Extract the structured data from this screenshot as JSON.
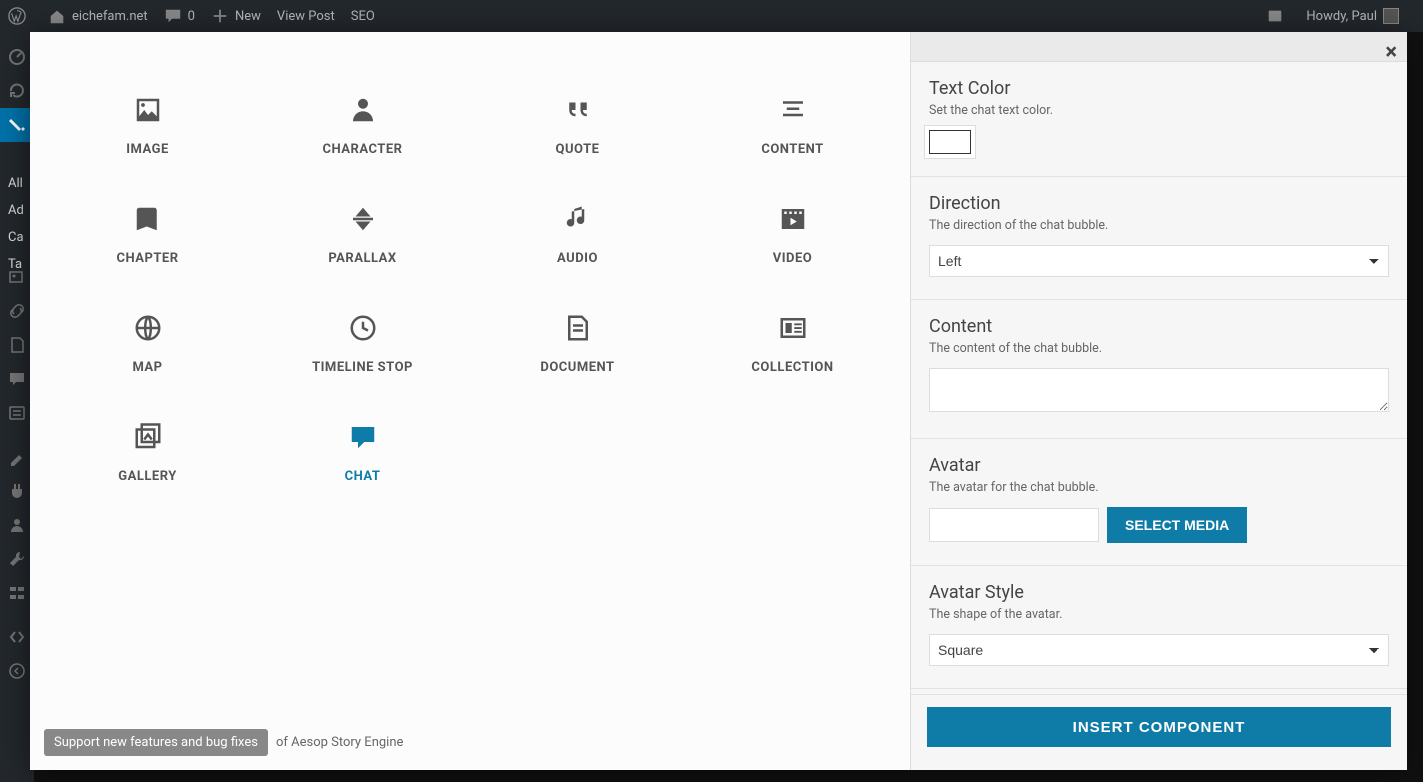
{
  "adminbar": {
    "site_name": "eichefam.net",
    "comments_count": "0",
    "new_label": "New",
    "view_post_label": "View Post",
    "seo_label": "SEO",
    "howdy_prefix": "Howdy,",
    "user_name": "Paul"
  },
  "sidebar_partial": {
    "items": [
      "All",
      "Ad",
      "Ca",
      "Ta"
    ]
  },
  "components": [
    {
      "key": "image",
      "label": "IMAGE"
    },
    {
      "key": "character",
      "label": "CHARACTER"
    },
    {
      "key": "quote",
      "label": "QUOTE"
    },
    {
      "key": "content",
      "label": "CONTENT"
    },
    {
      "key": "chapter",
      "label": "CHAPTER"
    },
    {
      "key": "parallax",
      "label": "PARALLAX"
    },
    {
      "key": "audio",
      "label": "AUDIO"
    },
    {
      "key": "video",
      "label": "VIDEO"
    },
    {
      "key": "map",
      "label": "MAP"
    },
    {
      "key": "timeline-stop",
      "label": "TIMELINE STOP"
    },
    {
      "key": "document",
      "label": "DOCUMENT"
    },
    {
      "key": "collection",
      "label": "COLLECTION"
    },
    {
      "key": "gallery",
      "label": "GALLERY"
    },
    {
      "key": "chat",
      "label": "CHAT",
      "selected": true
    }
  ],
  "support": {
    "button": "Support new features and bug fixes",
    "suffix": "of Aesop Story Engine"
  },
  "right_panel": {
    "text_color": {
      "title": "Text Color",
      "desc": "Set the chat text color.",
      "value": "#ffffff"
    },
    "direction": {
      "title": "Direction",
      "desc": "The direction of the chat bubble.",
      "value": "Left"
    },
    "content": {
      "title": "Content",
      "desc": "The content of the chat bubble.",
      "value": ""
    },
    "avatar": {
      "title": "Avatar",
      "desc": "The avatar for the chat bubble.",
      "value": "",
      "select_media_label": "SELECT MEDIA"
    },
    "avatar_style": {
      "title": "Avatar Style",
      "desc": "The shape of the avatar.",
      "value": "Square"
    },
    "insert_label": "INSERT COMPONENT"
  }
}
